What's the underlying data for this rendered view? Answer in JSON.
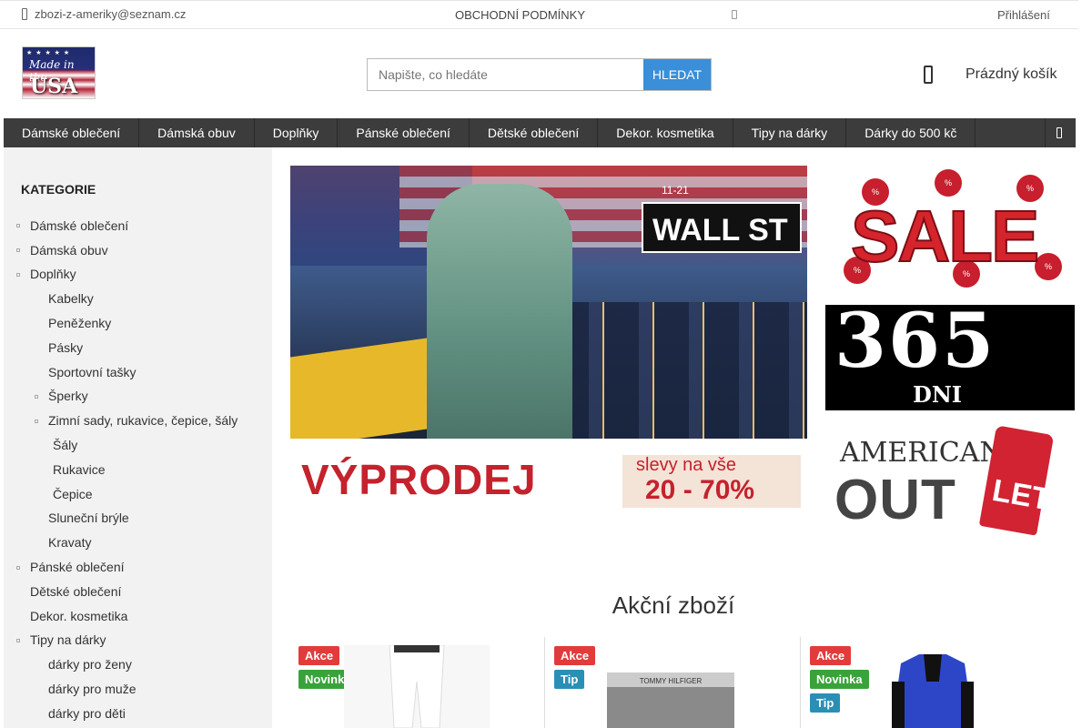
{
  "topbar": {
    "email": "zbozi-z-ameriky@seznam.cz",
    "terms": "OBCHODNÍ PODMÍNKY",
    "login": "Přihlášení"
  },
  "logo": {
    "line1": "Made in the",
    "line2": "USA"
  },
  "search": {
    "placeholder": "Napište, co hledáte",
    "button": "HLEDAT"
  },
  "cart": {
    "label": "Prázdný košík"
  },
  "nav": [
    "Dámské oblečení",
    "Dámská obuv",
    "Doplňky",
    "Pánské oblečení",
    "Dětské oblečení",
    "Dekor. kosmetika",
    "Tipy na dárky",
    "Dárky do 500 kč"
  ],
  "sidebar": {
    "title": "KATEGORIE",
    "items": [
      "Dámské oblečení",
      "Dámská obuv",
      "Doplňky",
      "Kabelky",
      "Peněženky",
      "Pásky",
      "Sportovní tašky",
      "Šperky",
      "Zimní sady, rukavice, čepice, šály",
      "Šály",
      "Rukavice",
      "Čepice",
      "Sluneční brýle",
      "Kravaty",
      "Pánské oblečení",
      "Dětské oblečení",
      "Dekor. kosmetika",
      "Tipy na dárky",
      "dárky pro ženy",
      "dárky pro muže",
      "dárky pro děti"
    ]
  },
  "banner": {
    "wall": "WALL ST",
    "street_num": "11-21",
    "headline": "VÝPRODEJ",
    "sub1": "slevy na vše",
    "sub2": "20 - 70%"
  },
  "promos": {
    "sale": "SALE",
    "days_num": "365",
    "days_label": "DNI",
    "outlet_top": "AMERICAN",
    "outlet_main": "OUT",
    "outlet_tag": "LET"
  },
  "section": {
    "title": "Akční zboží"
  },
  "products": [
    {
      "badges": [
        "Akce",
        "Novinka"
      ]
    },
    {
      "badges": [
        "Akce",
        "Tip"
      ],
      "brand": "TOMMY HILFIGER"
    },
    {
      "badges": [
        "Akce",
        "Novinka",
        "Tip"
      ]
    }
  ],
  "colors": {
    "accent": "#3a8fd8",
    "nav_bg": "#3c3c3c",
    "akce": "#e23b3b",
    "novinka": "#3aa23a",
    "tip": "#2a8fb5"
  }
}
